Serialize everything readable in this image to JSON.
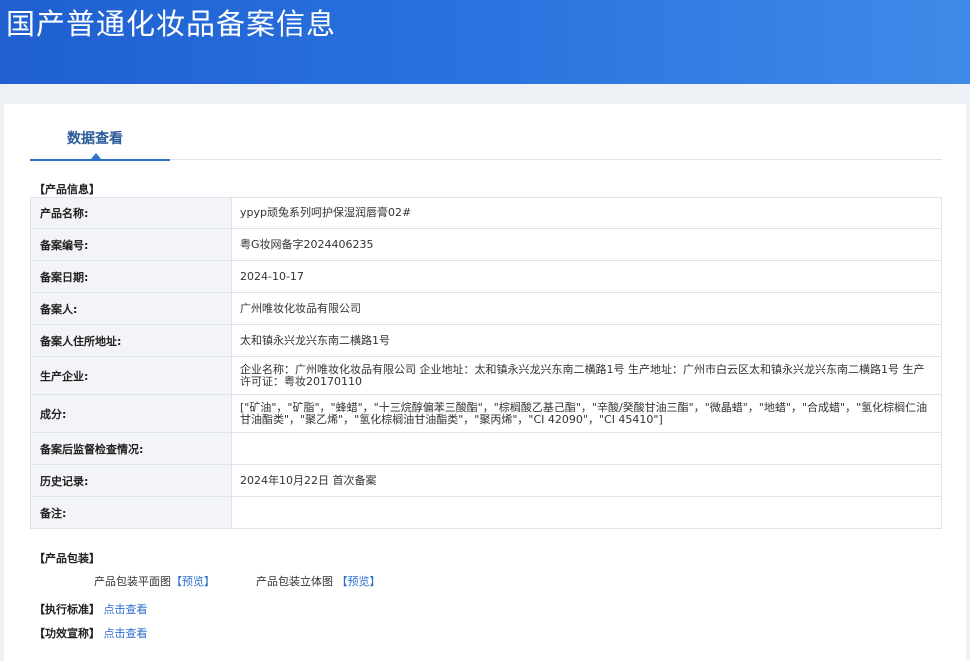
{
  "header": {
    "title": "国产普通化妆品备案信息"
  },
  "tab": {
    "label": "数据查看"
  },
  "product_section": {
    "label": "【产品信息】"
  },
  "rows": [
    {
      "key": "产品名称:",
      "value": "ypyp顽兔系列呵护保湿润唇膏02#"
    },
    {
      "key": "备案编号:",
      "value": "粤G妆网备字2024406235"
    },
    {
      "key": "备案日期:",
      "value": "2024-10-17"
    },
    {
      "key": "备案人:",
      "value": "广州唯妆化妆品有限公司"
    },
    {
      "key": "备案人住所地址:",
      "value": "太和镇永兴龙兴东南二横路1号"
    },
    {
      "key": "生产企业:",
      "value": "企业名称：广州唯妆化妆品有限公司 企业地址：太和镇永兴龙兴东南二横路1号 生产地址：广州市白云区太和镇永兴龙兴东南二横路1号 生产许可证：粤妆20170110"
    },
    {
      "key": "成分:",
      "value": "[\"矿油\"，\"矿脂\"，\"蜂蜡\"，\"十三烷醇偏苯三酸酯\"，\"棕榈酸乙基己酯\"，\"辛酸/癸酸甘油三酯\"，\"微晶蜡\"，\"地蜡\"，\"合成蜡\"，\"氢化棕榈仁油甘油酯类\"，\"聚乙烯\"，\"氢化棕榈油甘油酯类\"，\"聚丙烯\"，\"CI 42090\"，\"CI 45410\"]"
    },
    {
      "key": "备案后监督检查情况:",
      "value": ""
    },
    {
      "key": "历史记录:",
      "value": "2024年10月22日 首次备案"
    },
    {
      "key": "备注:",
      "value": ""
    }
  ],
  "packaging": {
    "label": "【产品包装】",
    "flat_label": "产品包装平面图",
    "flat_link": "【预览】",
    "stereo_label": "产品包装立体图",
    "stereo_link": "【预览】"
  },
  "standard": {
    "label": "【执行标准】",
    "link": "点击查看"
  },
  "efficacy": {
    "label": "【功效宣称】",
    "link": "点击查看"
  }
}
